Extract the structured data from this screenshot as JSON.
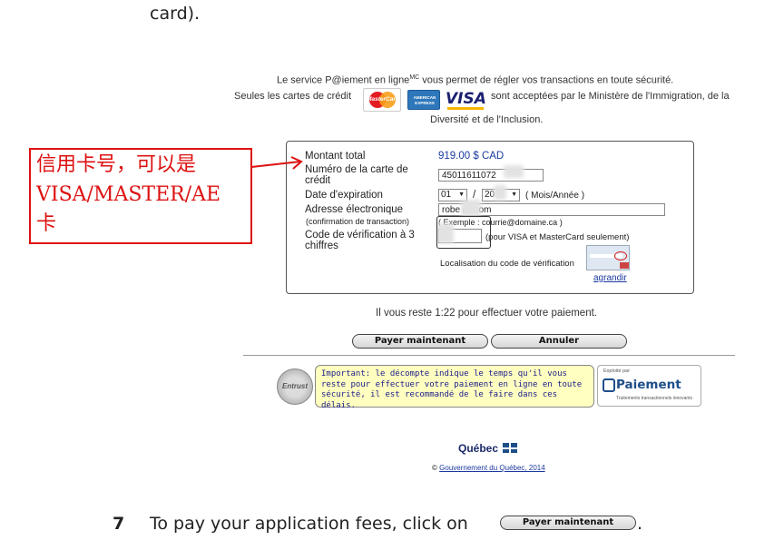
{
  "doc": {
    "top_fragment": "card).",
    "step_number": "7",
    "step_text": "To pay your application fees, click on",
    "step_button": "Payer maintenant",
    "step_end": "."
  },
  "intro": {
    "line1": "Le service P@iement en ligne",
    "line1_sup": "MC",
    "line1_rest": "vous permet de régler vos transactions en toute sécurité.",
    "line2_start": "Seules les cartes de crédit",
    "line2_end": "sont acceptées par le Ministère de l'Immigration, de la",
    "line3": "Diversité et de l'Inclusion.",
    "cards": [
      {
        "name": "MasterCard",
        "color": "#e31c23"
      },
      {
        "name": "AMERICAN EXPRESS",
        "color": "#2e77bb"
      },
      {
        "name": "VISA",
        "color": "#1a1f71"
      }
    ]
  },
  "form": {
    "amount_label": "Montant total",
    "amount_value": "919.00 $ CAD",
    "card_label": "Numéro de la carte de crédit",
    "card_value": "45011611072",
    "expiry_label": "Date d'expiration",
    "expiry_month": "01",
    "expiry_sep": "/",
    "expiry_year": "20",
    "expiry_hint": "( Mois/Année )",
    "email_label": "Adresse électronique",
    "email_sublabel": "(confirmation de transaction)",
    "email_value": "robe          ail.com",
    "email_hint": "( Exemple : courrie@domaine.ca )",
    "cvv_label": "Code de vérification à 3 chiffres",
    "cvv_hint": "(pour VISA et MasterCard seulement)",
    "cvv_location": "Localisation du code de vérification",
    "enlarge_link": "agrandir"
  },
  "annotation": {
    "text": "信用卡号，可以是VISA/MASTER/AE卡",
    "line1": "信用卡号，可以是",
    "line2": "VISA/MASTER/AE",
    "line3": "卡",
    "color": "#d11111"
  },
  "timer": "Il vous reste 1:22 pour effectuer votre paiement.",
  "buttons": {
    "pay": "Payer maintenant",
    "cancel": "Annuler"
  },
  "notice": {
    "text": "Important: le décompte indique le temps qu'il vous reste pour effectuer votre paiement en ligne en toute sécurité, il est recommandé de le faire dans ces délais."
  },
  "seal": {
    "label": "Entrust"
  },
  "paiement_logo": {
    "top": "Exploité par",
    "name": "Paiement",
    "tagline": "Traitements transactionnels innovants"
  },
  "footer": {
    "quebec": "Québec",
    "copyright_symbol": "©",
    "copyright_link": "Gouvernement du Québec, 2014"
  }
}
